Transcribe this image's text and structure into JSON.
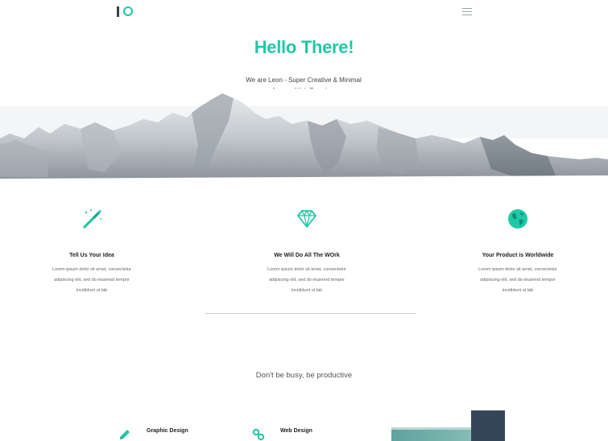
{
  "header": {
    "logo_name": "IO logo",
    "menu_icon": "hamburger-menu-icon"
  },
  "hero": {
    "title": "Hello There!",
    "subtitle_line1": "We are Leon - Super Creative & Minimal",
    "subtitle_line2": "Agency  Web Template",
    "image": "snowy mountain range"
  },
  "features": [
    {
      "icon": "magic-wand-icon",
      "title": "Tell Us Your Idea",
      "text_line1": "Lorem ipsum dolor sit amet, consectetur",
      "text_line2": "adipiscing elit, sed do eiusmod tempor",
      "text_line3": "incididunt ut lab"
    },
    {
      "icon": "diamond-icon",
      "title": "We Will Do All The WOrk",
      "text_line1": "Lorem ipsum dolor sit amet, consectetur",
      "text_line2": "adipiscing elit, sed do eiusmod tempor",
      "text_line3": "incididunt ut lab"
    },
    {
      "icon": "globe-icon",
      "title": "Your Product is Worldwide",
      "text_line1": "Lorem ipsum dolor sit amet, consectetur",
      "text_line2": "adipiscing elit, sed do eiusmod tempor",
      "text_line3": "incididunt ut lab"
    }
  ],
  "tagline": "Don't be busy, be productive",
  "services": [
    {
      "icon": "pencil-icon",
      "title": "Graphic Design"
    },
    {
      "icon": "link-icon",
      "title": "Web Design"
    }
  ],
  "colors": {
    "accent": "#1fc9a7",
    "dark": "#34475a",
    "teal_block": "#7db6b0"
  }
}
